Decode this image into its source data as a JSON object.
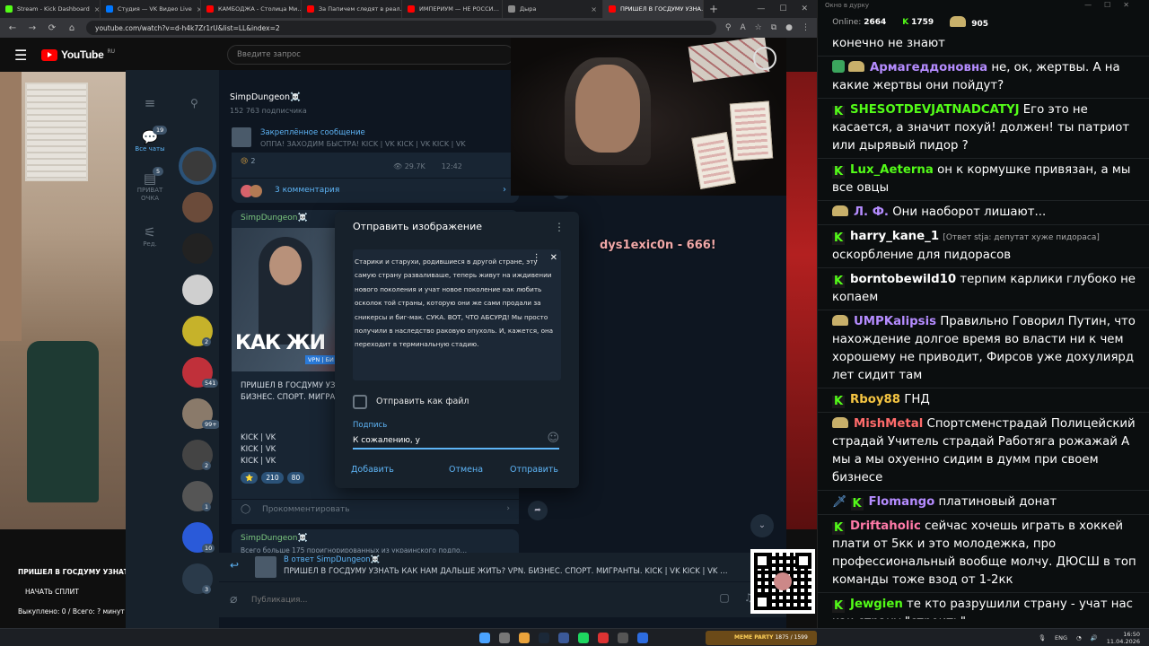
{
  "browser": {
    "tabs": [
      {
        "label": "Stream - Kick Dashboard",
        "color": "#53fc18",
        "active": false
      },
      {
        "label": "Студия — VK Видео Live",
        "color": "#0077ff",
        "active": false
      },
      {
        "label": "КАМБОДЖА - Столица Ми…",
        "color": "#ff0000",
        "active": false
      },
      {
        "label": "За Папичем следят в реал…",
        "color": "#ff0000",
        "active": false
      },
      {
        "label": "ИМПЕРИУМ — НЕ РОССИ…",
        "color": "#ff0000",
        "active": false
      },
      {
        "label": "Дыра",
        "color": "#8b8b8b",
        "active": false
      },
      {
        "label": "ПРИШЕЛ В ГОСДУМУ УЗНА…",
        "color": "#ff0000",
        "active": true
      }
    ],
    "url": "youtube.com/watch?v=d-h4k7Zr1rU&list=LL&index=2"
  },
  "youtube": {
    "logo": "YouTube",
    "region": "RU",
    "search_placeholder": "Введите запрос",
    "stream_title": "ПРИШЕЛ В ГОСДУМУ УЗНАТЬ",
    "split_button": "НАЧАТЬ СПЛИТ",
    "redeemed": "Выкуплено: 0 / Всего: ? минут"
  },
  "telegram": {
    "rail": {
      "all_chats": "Все чаты",
      "all_chats_badge": "19",
      "private": "ПРИВАТ ОЧКА",
      "private_badge": "5",
      "edit": "Ред."
    },
    "chat_list_badges": [
      "2",
      "541",
      "99+",
      "2",
      "1",
      "10",
      "3"
    ],
    "channel": {
      "name": "SimpDungeon☠️",
      "subscribers": "152 763 подписчика"
    },
    "pinned": {
      "label": "Закреплённое сообщение",
      "text": "ОППА! ЗАХОДИМ БЫСТРА! KICK | VK KICK | VK KICK | VK"
    },
    "post1": {
      "reaction": "😢",
      "reaction_count": "2",
      "views": "29.7K",
      "time": "12:42",
      "comments": "3 комментария"
    },
    "post2": {
      "author": "SimpDungeon☠️",
      "image_text": "КАК ЖИ",
      "image_tag": "VPN | БИ",
      "text": "ПРИШЕЛ В ГОСДУМУ УЗНАТЬ КАК НАМ ДАЛЬШЕ ЖИТЬ? VPN. БИЗНЕС. СПОРТ. МИГРАНТЫ.",
      "links": [
        "KICK | VK",
        "KICK | VK",
        "KICK | VK"
      ],
      "reactions": [
        "⭐",
        "210",
        "80"
      ],
      "comment_prompt": "Прокомментировать"
    },
    "post3": {
      "author": "SimpDungeon☠️",
      "text": "Всего больше 175 проигнорированных из украинского подпо…"
    },
    "reply": {
      "label": "В ответ SimpDungeon☠️",
      "text": "ПРИШЕЛ В ГОСДУМУ УЗНАТЬ КАК НАМ ДАЛЬШЕ ЖИТЬ? VPN. БИЗНЕС. СПОРТ. МИГРАНТЫ.  KICK | VK KICK | VK …"
    },
    "compose_placeholder": "Публикация..."
  },
  "overlay_name": "dys1exic0n - 666!",
  "dialog": {
    "title": "Отправить изображение",
    "image_text": "Старики и старухи, родившиеся в другой стране, эту самую страну разваливаше, теперь живут на иждивении нового поколения и учат новое поколение как любить осколок той страны, которую они же сами продали за сникерсы и биг-мак. СУКА. ВОТ, ЧТО АБСУРД! Мы просто получили в наследство раковую опухоль. И, кажется, она переходит в терминальную стадию.",
    "send_as_file": "Отправить как файл",
    "caption_label": "Подпись",
    "caption_value": "К сожалению, у",
    "add": "Добавить",
    "cancel": "Отмена",
    "send": "Отправить"
  },
  "chat": {
    "window_title": "Окно в дурку",
    "online_label": "Online:",
    "online_count": "2664",
    "followers": "1759",
    "subs": "905",
    "messages": [
      {
        "user": "",
        "color": "#ffffff",
        "badges": [],
        "reply": "",
        "text": "конечно не знают"
      },
      {
        "user": "Армагеддоновна",
        "color": "#b58cff",
        "badges": [
          "shield",
          "emote"
        ],
        "reply": "",
        "text": "не, ок, жертвы. А на какие жертвы они пойдут?"
      },
      {
        "user": "SHESOTDEVJATNADCATYJ",
        "color": "#53fc18",
        "badges": [
          "kick"
        ],
        "reply": "",
        "text": "Его это не касается, а значит похуй! должен! ты патриот или дырявый пидор ?"
      },
      {
        "user": "Lux_Aeterna",
        "color": "#53fc18",
        "badges": [
          "kick"
        ],
        "reply": "",
        "text": "он к кормушке привязан, а мы все овцы"
      },
      {
        "user": "Л. Ф.",
        "color": "#b58cff",
        "badges": [
          "emote"
        ],
        "reply": "",
        "text": "Они наоборот лишают..."
      },
      {
        "user": "harry_kane_1",
        "color": "#ffffff",
        "badges": [
          "kick"
        ],
        "reply": "[Ответ stja: депутат хуже пидораса]",
        "text": "оскорбление для пидорасов"
      },
      {
        "user": "borntobewild10",
        "color": "#ffffff",
        "badges": [
          "kick"
        ],
        "reply": "",
        "text": "терпим карлики глубоко не копаем"
      },
      {
        "user": "UMPKalipsis",
        "color": "#b58cff",
        "badges": [
          "emote"
        ],
        "reply": "",
        "text": "Правильно Говорил Путин, что нахождение долгое время во власти ни к чем хорошему не приводит, Фирсов уже дохулиярд лет сидит там"
      },
      {
        "user": "Rboy88",
        "color": "#f5c542",
        "badges": [
          "kick"
        ],
        "reply": "",
        "text": "ГНД"
      },
      {
        "user": "MishMetal",
        "color": "#ff6b6b",
        "badges": [
          "emote"
        ],
        "reply": "",
        "text": "Спортсменстрадай Полицейский страдай Учитель страдай Работяга рожажай А мы а мы охуенно сидим в думм при своем бизнесе"
      },
      {
        "user": "Flomango",
        "color": "#b58cff",
        "badges": [
          "sword",
          "kick"
        ],
        "reply": "",
        "text": "платиновый донат"
      },
      {
        "user": "Driftaholic",
        "color": "#ff7aa8",
        "badges": [
          "kick"
        ],
        "reply": "",
        "text": "сейчас хочешь играть в хоккей плати от 5кк и это молодежка, про профессиональный вообще молчу. ДЮСШ в топ команды тоже взод от 1-2кк"
      },
      {
        "user": "Jewgien",
        "color": "#53fc18",
        "badges": [
          "kick"
        ],
        "reply": "",
        "text": "те кто разрушили страну - учат нас как страну \"строить\""
      }
    ]
  },
  "taskbar": {
    "media_title": "MEME PARTY",
    "media_progress": "1875 / 1599",
    "lang": "ENG",
    "time": "16:50",
    "date": "11.04.2026"
  }
}
